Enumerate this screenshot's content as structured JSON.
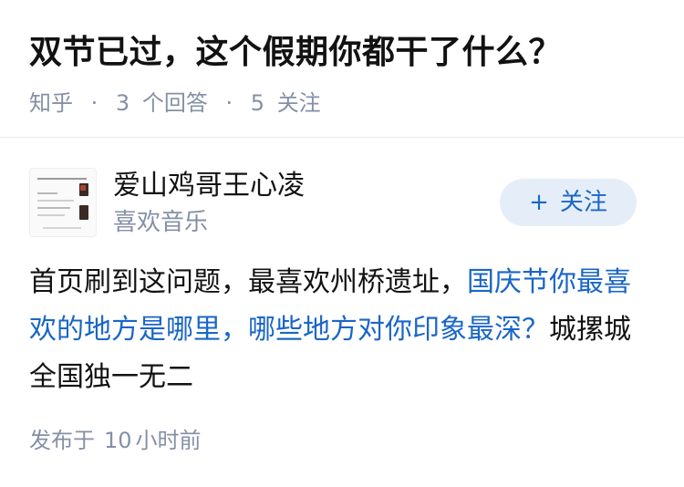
{
  "question": {
    "title": "双节已过，这个假期你都干了什么？",
    "source": "知乎",
    "separator": "·",
    "answer_count": "3",
    "answer_label": "个回答",
    "follower_count": "5",
    "follower_label": "关注"
  },
  "author": {
    "name": "爱山鸡哥王心凌",
    "bio": "喜欢音乐",
    "follow_icon": "plus-icon",
    "follow_plus": "+",
    "follow_label": "关注"
  },
  "answer": {
    "text_before": "首页刷到这问题，最喜欢州桥遗址，",
    "link_text": "国庆节你最喜欢的地方是哪里，哪些地方对你印象最深？",
    "text_after": "城摞城全国独一无二"
  },
  "footer": {
    "published_prefix": "发布于",
    "published_number": "10",
    "published_unit": "小时前"
  },
  "colors": {
    "accent": "#1a66c7",
    "muted": "#8590a6",
    "follow_bg": "#e5eef8"
  }
}
